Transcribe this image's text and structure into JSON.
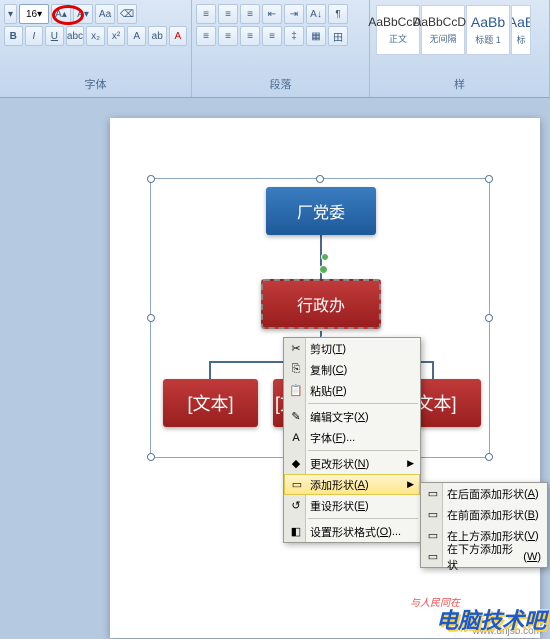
{
  "ribbon": {
    "font_size": "16",
    "groups": {
      "font": "字体",
      "paragraph": "段落",
      "styles": "样"
    },
    "styles": [
      {
        "preview": "AaBbCcDd",
        "label": "正文"
      },
      {
        "preview": "AaBbCcDd",
        "label": "无间隔"
      },
      {
        "preview": "AaBb",
        "label": "标题 1"
      },
      {
        "preview": "AaB",
        "label": "标"
      }
    ]
  },
  "smartart": {
    "root": "厂党委",
    "child": "行政办",
    "placeholder": "[文本]"
  },
  "context_menu": {
    "items": [
      {
        "label": "剪切",
        "hotkey": "T",
        "icon": "✂"
      },
      {
        "label": "复制",
        "hotkey": "C",
        "icon": "⎘"
      },
      {
        "label": "粘贴",
        "hotkey": "P",
        "icon": "📋"
      },
      {
        "label": "编辑文字",
        "hotkey": "X",
        "icon": "✎"
      },
      {
        "label": "字体",
        "hotkey": "F",
        "icon": "A",
        "arrow": false
      },
      {
        "label": "更改形状",
        "hotkey": "N",
        "icon": "◆",
        "arrow": true
      },
      {
        "label": "添加形状",
        "hotkey": "A",
        "icon": "▭",
        "arrow": true,
        "highlighted": true
      },
      {
        "label": "重设形状",
        "hotkey": "E",
        "icon": "↺"
      },
      {
        "label": "设置形状格式",
        "hotkey": "O",
        "icon": "◧",
        "arrow": false
      }
    ]
  },
  "submenu": {
    "items": [
      {
        "label": "在后面添加形状",
        "hotkey": "A",
        "icon": "▭"
      },
      {
        "label": "在前面添加形状",
        "hotkey": "B",
        "icon": "▭"
      },
      {
        "label": "在上方添加形状",
        "hotkey": "V",
        "icon": "▭"
      },
      {
        "label": "在下方添加形状",
        "hotkey": "W",
        "icon": "▭"
      }
    ]
  },
  "watermark": {
    "main": "电脑技术吧",
    "small": "与人民同在",
    "url": "www.dnjsb.com"
  }
}
